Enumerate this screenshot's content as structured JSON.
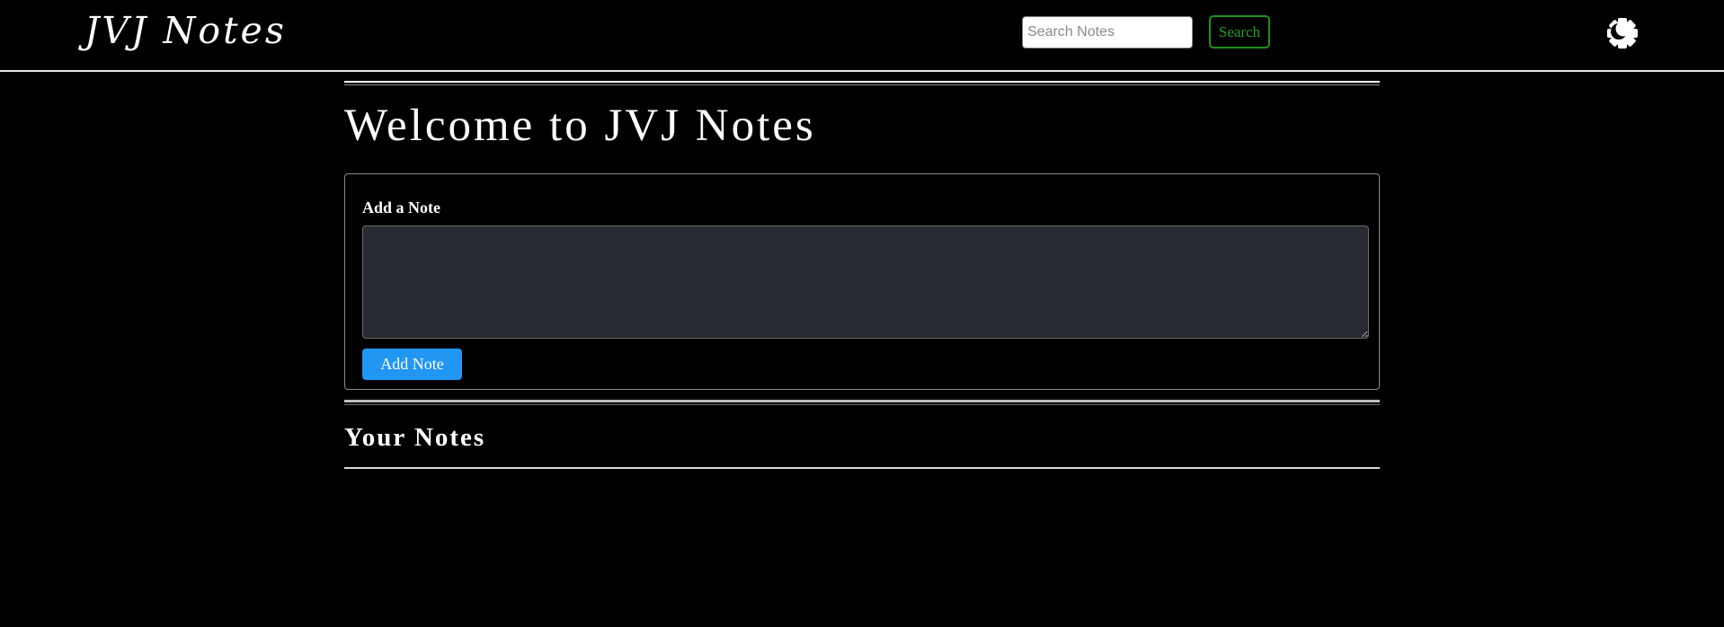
{
  "navbar": {
    "brand": "JVJ Notes",
    "search_placeholder": "Search Notes",
    "search_value": "",
    "search_button_label": "Search",
    "theme_toggle_icon": "theme-toggle-icon"
  },
  "main": {
    "title": "Welcome to JVJ Notes",
    "add_note": {
      "label": "Add a Note",
      "textarea_value": "",
      "button_label": "Add Note"
    },
    "notes_section": {
      "title": "Your Notes",
      "notes": []
    }
  },
  "colors": {
    "background": "#000000",
    "text": "#ffffff",
    "search_accent": "#22a022",
    "primary_button": "#2196f3",
    "textarea_bg": "#272a31"
  }
}
